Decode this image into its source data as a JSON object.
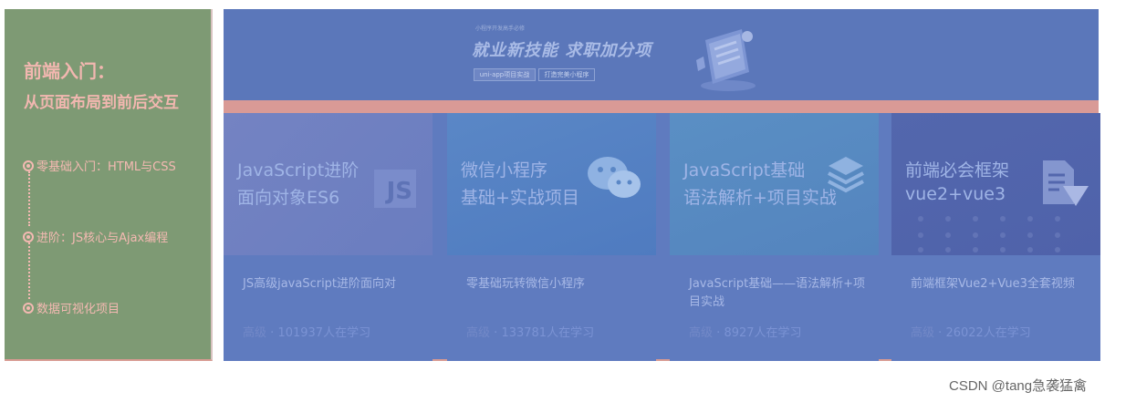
{
  "left_panel": {
    "title": "前端入门：",
    "subtitle": "从页面布局到前后交互",
    "steps": [
      "零基础入门：HTML与CSS",
      "进阶：JS核心与Ajax编程",
      "数据可视化项目"
    ]
  },
  "banner": {
    "small_text": "小程序开发高手必修",
    "headline": "就业新技能 求职加分项",
    "tag_primary": "uni-app项目实战",
    "tag_secondary": "打造完美小程序"
  },
  "cards": [
    {
      "thumb_line1": "JavaScript进阶",
      "thumb_line2": "面向对象ES6",
      "icon_text": "JS",
      "title": "JS高级javaScript进阶面向对",
      "level": "高级",
      "separator": "·",
      "learners": "101937人在学习"
    },
    {
      "thumb_line1": "微信小程序",
      "thumb_line2": "基础+实战项目",
      "title": "零基础玩转微信小程序",
      "level": "高级",
      "separator": "·",
      "learners": "133781人在学习"
    },
    {
      "thumb_line1": "JavaScript基础",
      "thumb_line2": "语法解析+项目实战",
      "title": "JavaScript基础——语法解析+项目实战",
      "level": "高级",
      "separator": "·",
      "learners": "8927人在学习"
    },
    {
      "thumb_line1": "前端必会框架",
      "thumb_line2": "vue2+vue3",
      "title": "前端框架Vue2+Vue3全套视频",
      "level": "高级",
      "separator": "·",
      "learners": "26022人在学习"
    }
  ],
  "watermark": "CSDN @tang急袭猛禽",
  "colors": {
    "left_panel_bg": "#7e9a74",
    "accent_pink": "#f2b7b0",
    "main_blue": "#5f7bbf",
    "strip_pink": "#d99a96"
  }
}
